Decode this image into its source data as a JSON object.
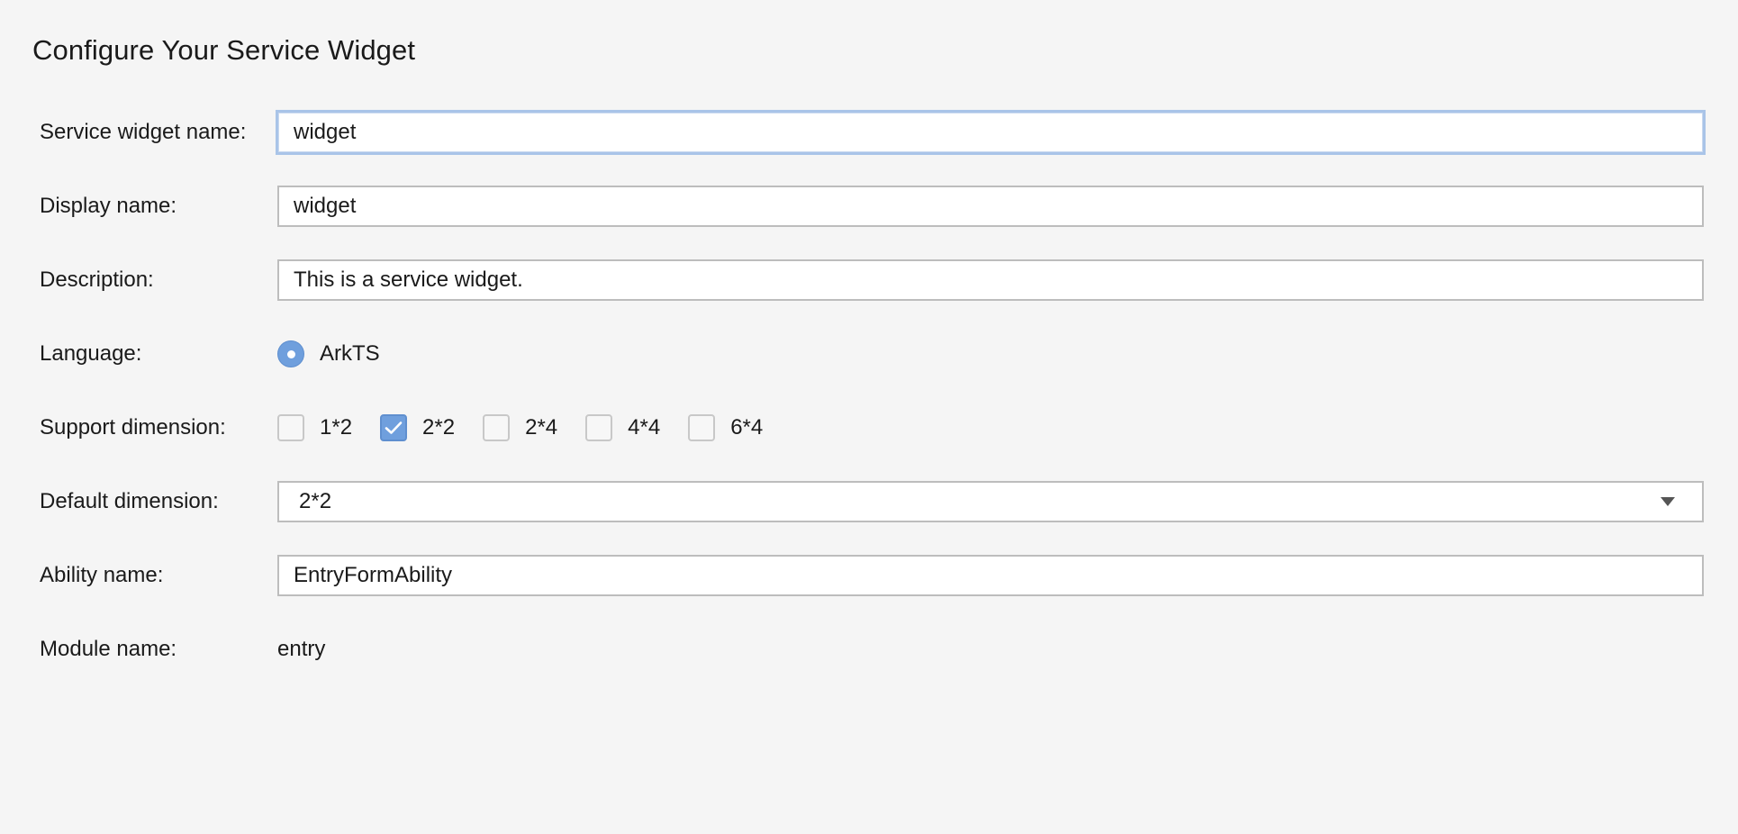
{
  "page": {
    "title": "Configure Your Service Widget"
  },
  "form": {
    "widget_name": {
      "label": "Service widget name:",
      "value": "widget"
    },
    "display_name": {
      "label": "Display name:",
      "value": "widget"
    },
    "description": {
      "label": "Description:",
      "value": "This is a service widget."
    },
    "language": {
      "label": "Language:",
      "selected_option": "ArkTS"
    },
    "support_dimension": {
      "label": "Support dimension:",
      "options": [
        {
          "label": "1*2",
          "checked": false
        },
        {
          "label": "2*2",
          "checked": true
        },
        {
          "label": "2*4",
          "checked": false
        },
        {
          "label": "4*4",
          "checked": false
        },
        {
          "label": "6*4",
          "checked": false
        }
      ]
    },
    "default_dimension": {
      "label": "Default dimension:",
      "value": "2*2",
      "icon": "chevron-down-icon"
    },
    "ability_name": {
      "label": "Ability name:",
      "value": "EntryFormAbility"
    },
    "module_name": {
      "label": "Module name:",
      "value": "entry"
    }
  },
  "colors": {
    "background": "#f5f5f5",
    "accent": "#6f9fdd",
    "focus_border": "#a9c4e8",
    "field_border": "#bdbdbd"
  }
}
